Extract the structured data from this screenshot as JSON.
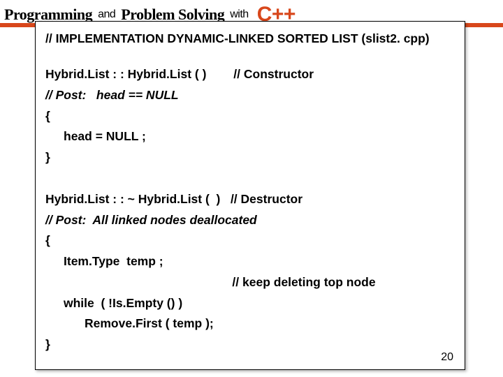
{
  "header": {
    "programming": "Programming",
    "and": "and",
    "problem_solving": "Problem Solving",
    "with": "with",
    "cpp": "C++"
  },
  "slide": {
    "title": "// IMPLEMENTATION DYNAMIC-LINKED SORTED LIST (slist2. cpp)",
    "ctor_sig": "Hybrid.List : : Hybrid.List ( )        // Constructor",
    "ctor_post": "// Post:   head == NULL",
    "open1": "{",
    "ctor_body": "head = NULL ;",
    "close1": "}",
    "dtor_sig": "Hybrid.List : : ~ Hybrid.List (  )   // Destructor",
    "dtor_post": "// Post:  All linked nodes deallocated",
    "open2": "{",
    "dtor_decl": "Item.Type  temp ;",
    "dtor_comment": "                                                       // keep deleting top node",
    "dtor_while": "while  ( !Is.Empty () )",
    "dtor_remove": "Remove.First ( temp );",
    "close2": "}",
    "page": "20"
  }
}
